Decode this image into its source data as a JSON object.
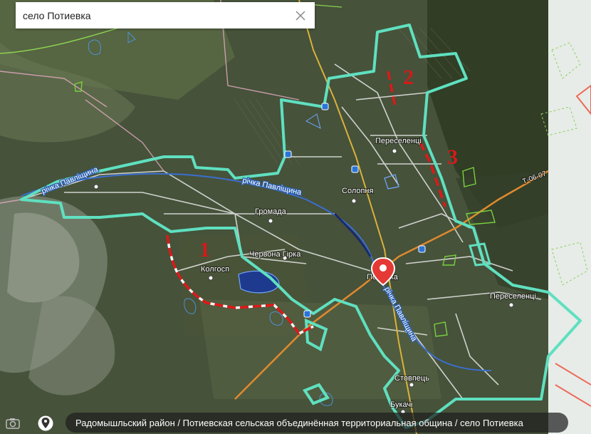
{
  "search": {
    "value": "село Потиевка"
  },
  "breadcrumb": {
    "text": "Радомышльский район / Потиевская сельская объединённая территориальная община / село Потиевка"
  },
  "map": {
    "places": [
      "Переселенці",
      "Солопня",
      "Громада",
      "Червона Гірка",
      "Колгосп",
      "Потієвка",
      "Переселенці",
      "Стовпець",
      "Букачі"
    ],
    "rivers": [
      "річка Павліщина",
      "річка Павліщина",
      "річка Павліщина"
    ],
    "road_label": "Т-06-07",
    "zones": [
      "1",
      "2",
      "3"
    ],
    "colors": {
      "boundary": "#5fe0c0",
      "highlight": "#e01818",
      "river": "#3a6fd0",
      "road_main": "#e08a2e",
      "satellite_base": "#46523a"
    }
  },
  "icons": {
    "clear": "close-icon",
    "camera": "camera-icon",
    "pin": "location-pin-icon",
    "marker": "map-marker-icon"
  }
}
